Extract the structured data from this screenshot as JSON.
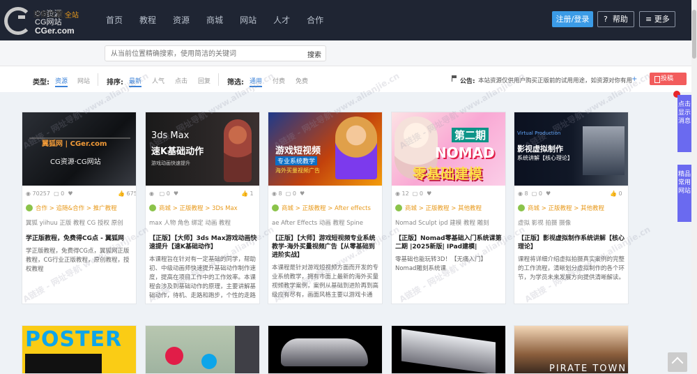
{
  "logo": {
    "line1": "CG资源",
    "line2": "CG网站",
    "line3": "CGer.com"
  },
  "nav": [
    "首页",
    "教程",
    "资源",
    "商城",
    "网站",
    "人才",
    "合作"
  ],
  "header_buttons": {
    "login": "注册/登录",
    "help": "帮助",
    "more": "更多"
  },
  "location": {
    "label": "当前位置:",
    "value": "全站"
  },
  "search": {
    "placeholder": "从当前位置精确搜索，使用简洁的关键词",
    "button": "搜索"
  },
  "filters": {
    "type_label": "类型:",
    "type_items": [
      "资源",
      "网站"
    ],
    "sort_label": "排序:",
    "sort_items": [
      "最新",
      "人气",
      "点击",
      "回复"
    ],
    "filter_label": "筛选:",
    "filter_items": [
      "通用",
      "付费",
      "免费"
    ]
  },
  "notice": {
    "label": "公告:",
    "text": "本站资源仅供用户购买正版前的试用用途，如资源对你有用",
    "plus": "+"
  },
  "post_button": "投稿",
  "side_tabs": {
    "show_msg": "点击显示消息",
    "links": "精品常用网站"
  },
  "watermark": "A链接 - 网址导航  www.alianjie.cn",
  "cards": [
    {
      "thumb_text": "CG资源·CG网站",
      "thumb_sub": "翼狐网 | CGer.com",
      "views": "70257",
      "comments": "0",
      "likes": "675",
      "crumb": "合作 > 追随&合作 > 推广教程",
      "tags": "翼狐 yiihuu 正版 教程 CG 授权 原创",
      "title": "学正版教程，免费得CG点 - 翼狐网",
      "desc": "学正版教程，免费得CG点，翼狐网正版教程，CG行业正版教程，原创教程，授权教程"
    },
    {
      "thumb_text": "3ds Max",
      "thumb_sub": "速K基础动作",
      "thumb_cap": "游戏动画快速提升",
      "views": "",
      "comments": "0",
      "likes": "1",
      "crumb": "商城 > 正版教程 > 3Ds Max",
      "tags": "max 人物 角色 绑定 动画 教程",
      "title": "【正版】【大师】3ds Max游戏动画快速提升【速K基础动作】",
      "desc": "本课程旨在针对有一定基础的同学，帮助初、中级动画师快速提升基础动作制作速度，提高在项目工作中的工作效率。本课程会涉及到基础动作的原理，主要讲解基础动作，待机、走路和跑步，个性的走路"
    },
    {
      "thumb_text": "游戏短视频",
      "thumb_sub": "专业系统教学",
      "thumb_cap": "海外买量视频广告",
      "views": "8",
      "comments": "0",
      "likes": "",
      "crumb": "商城 > 正版教程 > After effects",
      "tags": "ae After Effects 动画 教程 Spine",
      "title": "【正版】【大师】游戏短视频专业系统教学-海外买量视频广告【从零基础到进阶实战】",
      "desc": "本课程是针对游戏短视频方面而开发的专业系统教学，拥有市面上最新的海外买量视频教学案例，案例从基础到进阶再到高级应有尽有，画面风格主要以游戏卡通"
    },
    {
      "thumb_text": "第二期",
      "thumb_sub": "NOMAD",
      "thumb_cap": "零基础建模",
      "views": "12",
      "comments": "0",
      "likes": "",
      "crumb": "商城 > 正版教程 > 其他教程",
      "tags": "Nomad Sculpt ipd 建模 教程 雕刻",
      "title": "【正版】Nomad零基础入门系统课第二期 |2025新版| IPad建模|",
      "desc": "零基础也能玩转3D！【无痛入门】Nomad雕刻系统课"
    },
    {
      "thumb_text": "影视虚拟制作",
      "thumb_sub": "系统讲解【核心理论】",
      "thumb_cap": "Virtual Production",
      "views": "8",
      "comments": "0",
      "likes": "0",
      "crumb": "商城 > 正版教程 > 其他教程",
      "tags": "虚拟 影视 拍摄 摄像",
      "title": "【正版】影视虚拟制作系统讲解【核心理论】",
      "desc": "课程将详细介绍虚拟拍摄真实案例的完整的工作流程，清晰划分虚拟制作的各个环节，为学员未来发展方向提供清晰解读。"
    }
  ],
  "row2": [
    {
      "thumb_text": "POSTER"
    },
    {
      "thumb_text": ""
    },
    {
      "thumb_text": ""
    },
    {
      "thumb_text": ""
    },
    {
      "thumb_text": "PIRATE TOWN"
    }
  ]
}
